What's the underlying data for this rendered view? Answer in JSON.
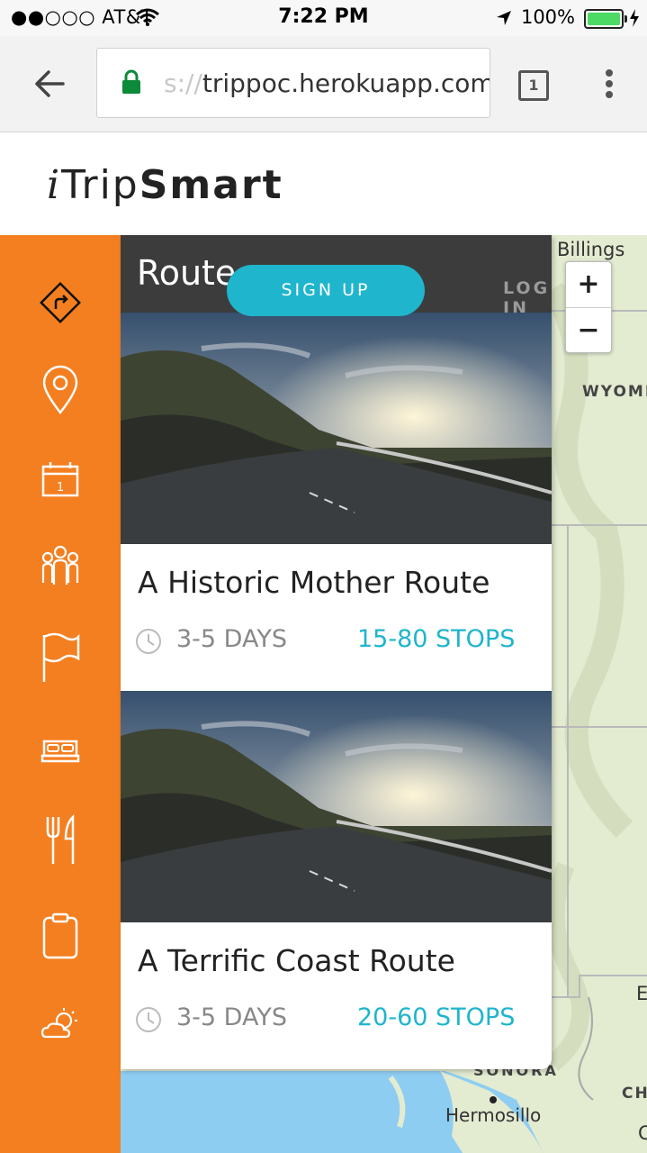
{
  "status_bar": {
    "carrier": "●●○○○ AT&T",
    "time": "7:22 PM",
    "battery": "100%"
  },
  "browser": {
    "url_scheme": "s://",
    "url_host": "trippoc.herokuapp.com",
    "tab_count": "1"
  },
  "logo": {
    "i": "i",
    "trip": "Trip",
    "smart": "Smart"
  },
  "panel": {
    "title": "Route",
    "sign_up": "SIGN UP",
    "log_in": "LOG IN"
  },
  "routes": [
    {
      "name": "A Historic Mother Route",
      "days": "3-5 DAYS",
      "stops": "15-80 STOPS"
    },
    {
      "name": "A Terrific Coast Route",
      "days": "3-5 DAYS",
      "stops": "20-60 STOPS"
    }
  ],
  "map": {
    "labels": {
      "billings": "Billings",
      "wyoming": "WYOMI",
      "e": "E",
      "sonora": "SONORA",
      "hermosillo": "Hermosillo",
      "ch": "CH",
      "c": "C"
    },
    "zoom_in": "+",
    "zoom_out": "−"
  },
  "sidebar": {
    "items": [
      "route-sign-icon",
      "location-pin-icon",
      "calendar-icon",
      "group-icon",
      "flag-icon",
      "bed-icon",
      "fork-knife-icon",
      "clipboard-icon",
      "weather-icon"
    ],
    "calendar_day": "1"
  },
  "colors": {
    "accent": "#f47f20",
    "teal": "#1fb5cd",
    "header": "#3c3c3c"
  }
}
